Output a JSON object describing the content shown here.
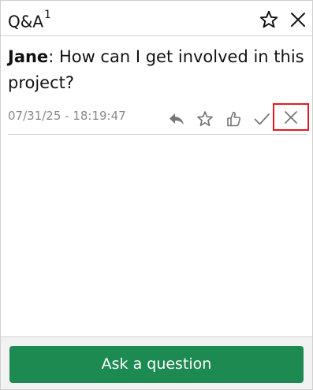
{
  "header": {
    "title": "Q&A",
    "count": "1",
    "favorite_icon": "star-outline-icon",
    "close_icon": "close-icon"
  },
  "question": {
    "author": "Jane",
    "text": ": How can I get involved in this project?",
    "timestamp": "07/31/25 - 18:19:47",
    "actions": [
      "reply-icon",
      "star-icon",
      "thumbs-up-icon",
      "check-icon",
      "dismiss-icon"
    ]
  },
  "footer": {
    "ask_label": "Ask a question",
    "button_color": "#1d8a52"
  },
  "colors": {
    "highlight": "#e21b23",
    "timestamp": "#8a8a8a",
    "icon": "#777777"
  }
}
